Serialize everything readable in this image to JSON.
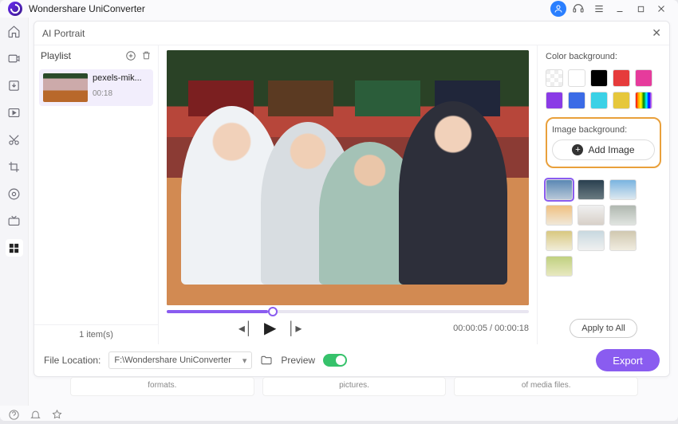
{
  "titlebar": {
    "title": "Wondershare UniConverter"
  },
  "modal": {
    "title": "AI Portrait"
  },
  "playlist": {
    "title": "Playlist",
    "item": {
      "name": "pexels-mik...",
      "duration": "00:18"
    },
    "count_label": "1 item(s)"
  },
  "player": {
    "time_current": "00:00:05",
    "time_total": "00:00:18"
  },
  "rpanel": {
    "color_label": "Color background:",
    "colors": [
      "transparent",
      "#ffffff",
      "#000000",
      "#e63b3b",
      "#e63b9c",
      "#8a3be6",
      "#3b6be6",
      "#3bd1e6",
      "#e6c73b",
      "rainbow"
    ],
    "image_label": "Image background:",
    "add_image_label": "Add Image",
    "apply_label": "Apply to All"
  },
  "footer": {
    "file_location_label": "File Location:",
    "file_location_value": "F:\\Wondershare UniConverter",
    "preview_label": "Preview",
    "export_label": "Export"
  },
  "bottomcards": {
    "c1": "formats.",
    "c2": "pictures.",
    "c3": "of media files."
  }
}
